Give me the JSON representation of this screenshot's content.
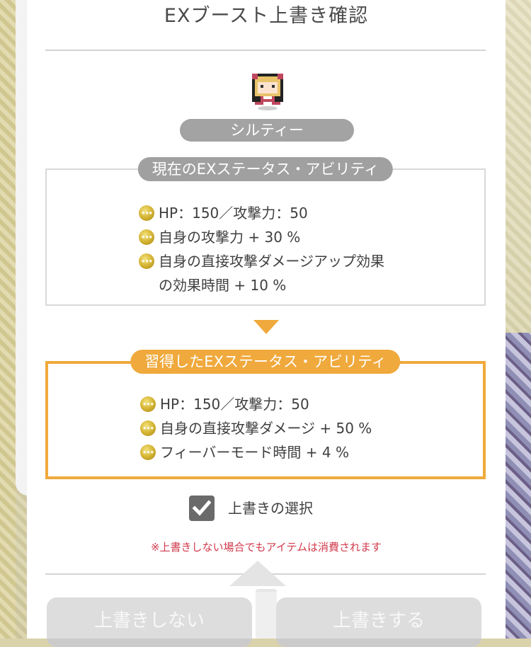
{
  "dialog": {
    "title": "EXブースト上書き確認",
    "character_name": "シルティー",
    "current": {
      "header": "現在のEXステータス・アビリティ",
      "items": [
        "HP：150／攻撃力：50",
        "自身の攻撃力 + 30 %",
        "自身の直接攻撃ダメージアップ効果の効果時間 + 10 %"
      ]
    },
    "acquired": {
      "header": "習得したEXステータス・アビリティ",
      "items": [
        "HP：150／攻撃力：50",
        "自身の直接攻撃ダメージ + 50 %",
        "フィーバーモード時間 + 4 %"
      ]
    },
    "overwrite_checkbox": {
      "label": "上書きの選択",
      "checked": true
    },
    "warning": "※上書きしない場合でもアイテムは消費されます",
    "buttons": {
      "cancel": "上書きしない",
      "confirm": "上書きする"
    },
    "coin_icon_text": "★★★"
  },
  "colors": {
    "accent": "#f0a93c",
    "pill_gray": "#a3a3a3",
    "warning": "#d23a4c",
    "button_disabled": "#cbcbcb"
  }
}
